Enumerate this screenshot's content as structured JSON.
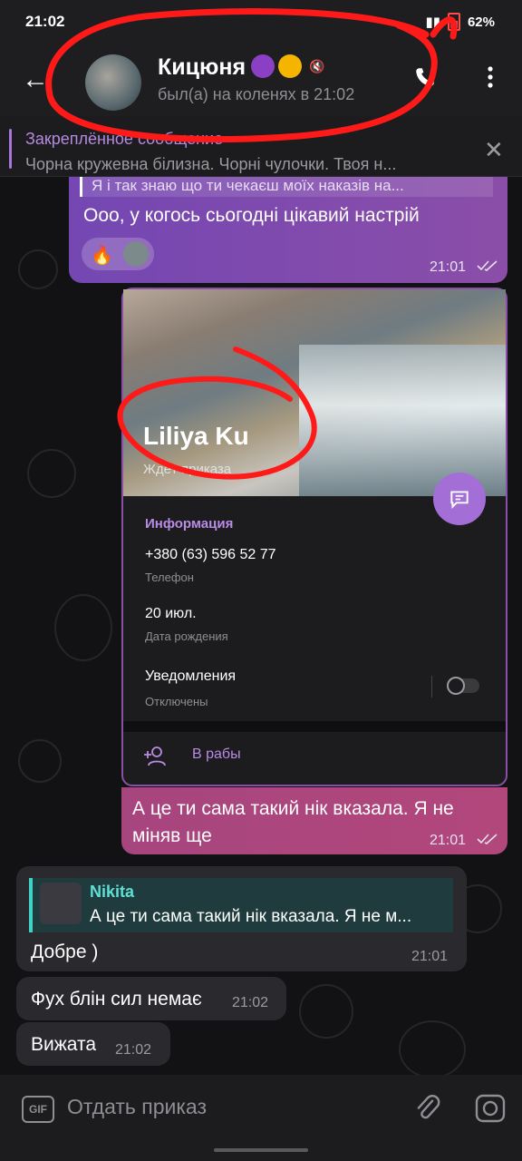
{
  "status_bar": {
    "time": "21:02",
    "battery": "62%"
  },
  "header": {
    "contact_name": "Кицюня",
    "last_seen": "был(а) на коленях в 21:02"
  },
  "pinned": {
    "title": "Закреплённое сообщение",
    "text": "Чорна кружевна білизна. Чорні чулочки.  Твоя н..."
  },
  "messages": {
    "out1": {
      "reply_snippet": "Я і так знаю що ти чекаєш моїх наказів на...",
      "text": "Ооо, у когось сьогодні цікавий настрій",
      "time": "21:01",
      "reaction": "🔥"
    },
    "profile_card": {
      "name": "Liliya Ku",
      "status": "Ждёт приказа",
      "section_title": "Информация",
      "phone": "+380 (63) 596 52 77",
      "phone_label": "Телефон",
      "birthday": "20 июл.",
      "birthday_label": "Дата рождения",
      "notifications": "Уведомления",
      "notifications_state": "Отключены",
      "add_action": "В рабы"
    },
    "out2": {
      "line1": "А це ти сама такий нік вказала. Я не",
      "line2": "міняв ще",
      "time": "21:01"
    },
    "in1": {
      "reply_name": "Nikita",
      "reply_text": "А це ти сама такий нік вказала. Я не м...",
      "text": "Добре )",
      "time": "21:01"
    },
    "in2": {
      "text": "Фух блін сил немає",
      "time": "21:02"
    },
    "in3": {
      "text": "Вижата",
      "time": "21:02"
    }
  },
  "input": {
    "gif_label": "GIF",
    "placeholder": "Отдать приказ"
  },
  "colors": {
    "accent": "#a36fd6",
    "outgoing": "#7447b3",
    "outgoing_alt": "#b2477b",
    "incoming": "#2a2a2e",
    "reply_accent": "#3fd2c7",
    "annotation": "#ff1a1a"
  }
}
